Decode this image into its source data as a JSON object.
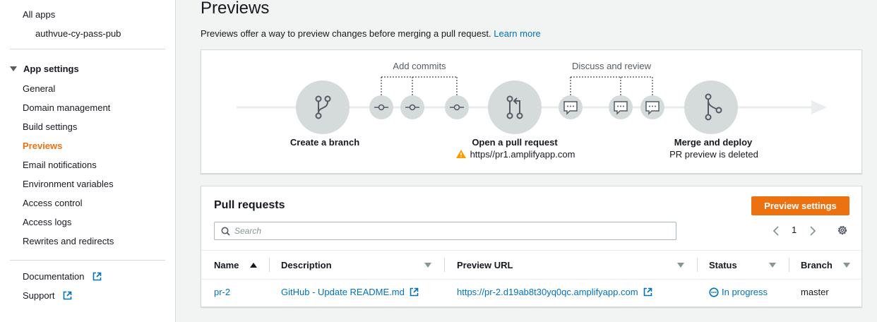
{
  "sidebar": {
    "all_apps": "All apps",
    "app_name": "authvue-cy-pass-pub",
    "section_title": "App settings",
    "items": [
      {
        "label": "General"
      },
      {
        "label": "Domain management"
      },
      {
        "label": "Build settings"
      },
      {
        "label": "Previews",
        "active": true
      },
      {
        "label": "Email notifications"
      },
      {
        "label": "Environment variables"
      },
      {
        "label": "Access control"
      },
      {
        "label": "Access logs"
      },
      {
        "label": "Rewrites and redirects"
      }
    ],
    "footer": [
      {
        "label": "Documentation",
        "icon": "external-link-icon"
      },
      {
        "label": "Support",
        "icon": "external-link-icon"
      }
    ]
  },
  "main": {
    "title": "Previews",
    "description": "Previews offer a way to preview changes before merging a pull request.",
    "learn_more": "Learn more"
  },
  "diagram": {
    "add_commits": "Add commits",
    "discuss_review": "Discuss and review",
    "create_branch": "Create a branch",
    "open_pr": "Open a pull request",
    "pr_url": "https//pr1.amplifyapp.com",
    "merge_deploy": "Merge and deploy",
    "pr_deleted": "PR preview is deleted"
  },
  "pull_requests": {
    "title": "Pull requests",
    "preview_settings": "Preview settings",
    "search_placeholder": "Search",
    "page": "1",
    "columns": [
      "Name",
      "Description",
      "Preview URL",
      "Status",
      "Branch"
    ],
    "rows": [
      {
        "name": "pr-2",
        "description": "GitHub - Update README.md",
        "preview_url": "https://pr-2.d19ab8t30yq0qc.amplifyapp.com",
        "status": "In progress",
        "branch": "master"
      }
    ]
  },
  "colors": {
    "accent": "#ec7211",
    "link": "#0073bb",
    "warning": "#ff9900",
    "diagram_circle": "#d5dbdb"
  }
}
